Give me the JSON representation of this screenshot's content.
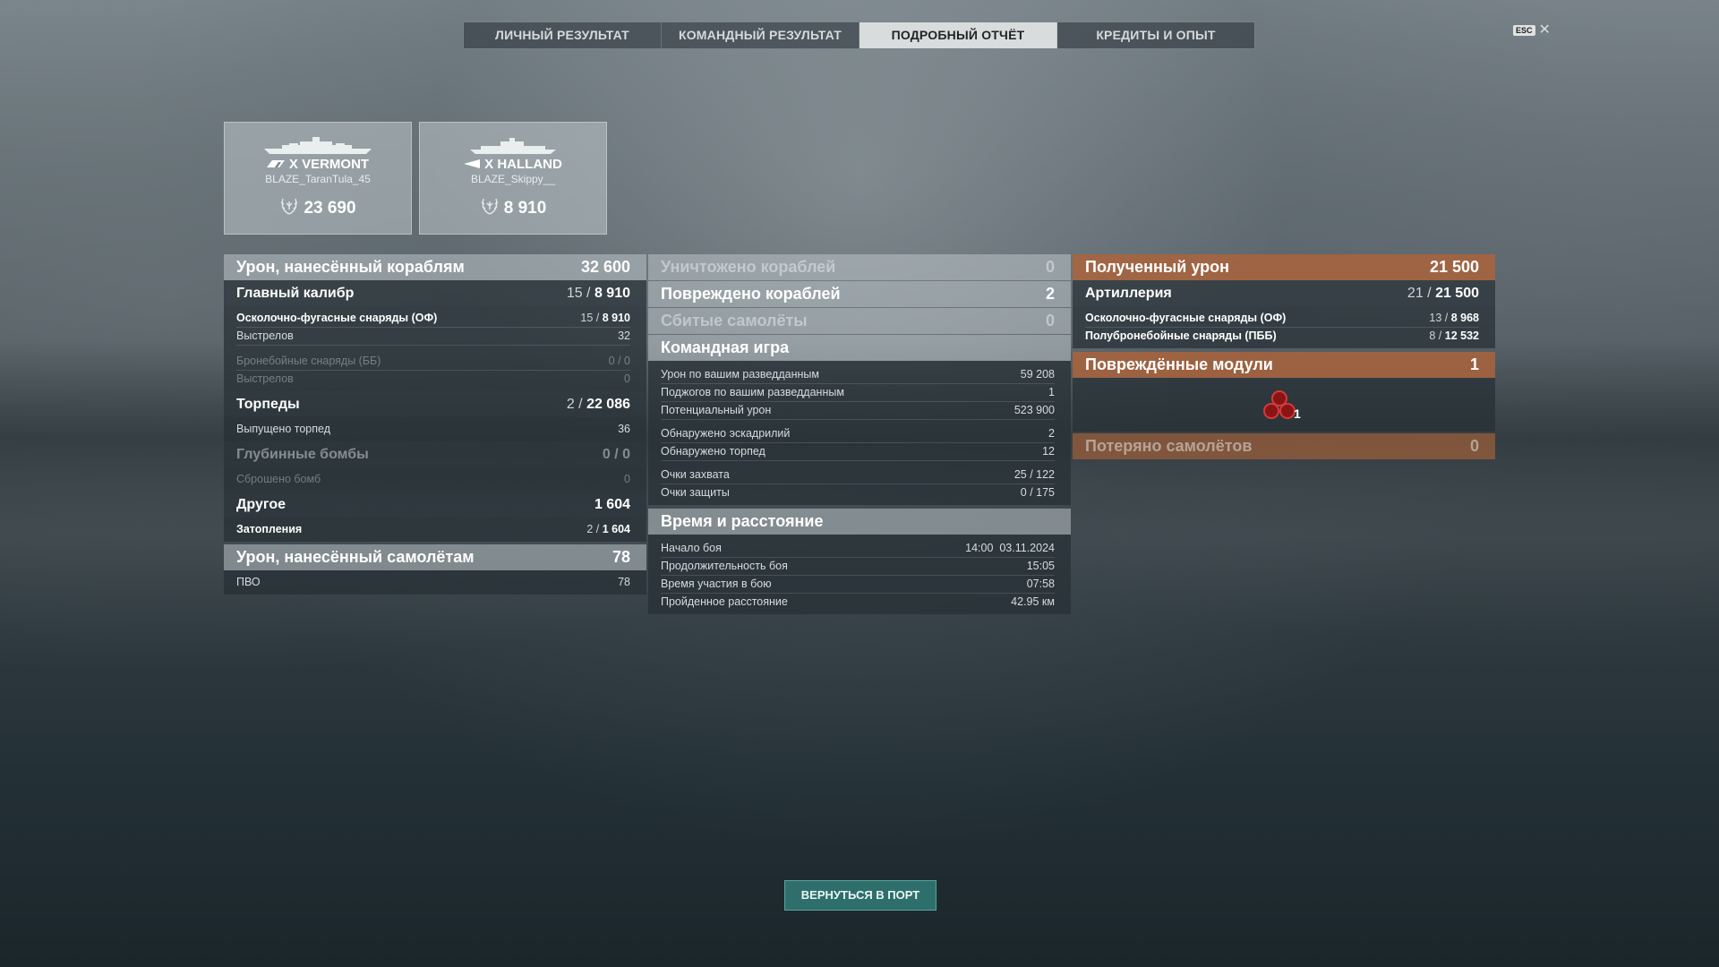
{
  "tabs": [
    "ЛИЧНЫЙ РЕЗУЛЬТАТ",
    "КОМАНДНЫЙ РЕЗУЛЬТАТ",
    "ПОДРОБНЫЙ ОТЧЁТ",
    "КРЕДИТЫ И ОПЫТ"
  ],
  "active_tab": "ПОДРОБНЫЙ ОТЧЁТ",
  "esc": {
    "key": "ESC",
    "close": "✕"
  },
  "ships": [
    {
      "name": "X VERMONT",
      "player": "BLAZE_TaranTula_45",
      "score": "23 690"
    },
    {
      "name": "X HALLAND",
      "player": "BLAZE_Skippy__",
      "score": "8 910"
    }
  ],
  "left": {
    "ship_damage": {
      "label": "Урон, нанесённый кораблям",
      "value": "32 600"
    },
    "main_battery": {
      "label": "Главный калибр",
      "hits": "15 /",
      "value": "8 910"
    },
    "he": {
      "label": "Осколочно-фугасные снаряды (ОФ)",
      "hits": "15 /",
      "value": "8 910"
    },
    "he_shots": {
      "label": "Выстрелов",
      "value": "32"
    },
    "ap": {
      "label": "Бронебойные снаряды (ББ)",
      "value": "0 / 0"
    },
    "ap_shots": {
      "label": "Выстрелов",
      "value": "0"
    },
    "torpedoes": {
      "label": "Торпеды",
      "hits": "2 /",
      "value": "22 086"
    },
    "torps_launched": {
      "label": "Выпущено торпед",
      "value": "36"
    },
    "depth_charges": {
      "label": "Глубинные бомбы",
      "value": "0 / 0"
    },
    "bombs_dropped": {
      "label": "Сброшено бомб",
      "value": "0"
    },
    "other": {
      "label": "Другое",
      "value": "1 604"
    },
    "flooding": {
      "label": "Затопления",
      "hits": "2 /",
      "value": "1 604"
    },
    "plane_damage": {
      "label": "Урон, нанесённый самолётам",
      "value": "78"
    },
    "aa": {
      "label": "ПВО",
      "value": "78"
    }
  },
  "middle": {
    "destroyed": {
      "label": "Уничтожено кораблей",
      "value": "0"
    },
    "damaged": {
      "label": "Повреждено кораблей",
      "value": "2"
    },
    "planes_shot": {
      "label": "Сбитые самолёты",
      "value": "0"
    },
    "teamplay": {
      "label": "Командная игра"
    },
    "spot_damage": {
      "label": "Урон по вашим разведданным",
      "value": "59 208"
    },
    "spot_fires": {
      "label": "Поджогов по вашим разведданным",
      "value": "1"
    },
    "potential": {
      "label": "Потенциальный урон",
      "value": "523 900"
    },
    "squadrons": {
      "label": "Обнаружено эскадрилий",
      "value": "2"
    },
    "torps_spotted": {
      "label": "Обнаружено торпед",
      "value": "12"
    },
    "capture": {
      "label": "Очки захвата",
      "value": "25 / 122"
    },
    "defense": {
      "label": "Очки защиты",
      "value": "0 / 175"
    },
    "time_header": {
      "label": "Время и расстояние"
    },
    "start": {
      "label": "Начало боя",
      "value": "14:00  03.11.2024"
    },
    "duration": {
      "label": "Продолжительность боя",
      "value": "15:05"
    },
    "participation": {
      "label": "Время участия в бою",
      "value": "07:58"
    },
    "distance": {
      "label": "Пройденное расстояние",
      "value": "42.95 км"
    }
  },
  "right": {
    "received": {
      "label": "Полученный урон",
      "value": "21 500"
    },
    "artillery": {
      "label": "Артиллерия",
      "hits": "21 /",
      "value": "21 500"
    },
    "he": {
      "label": "Осколочно-фугасные снаряды (ОФ)",
      "hits": "13 /",
      "value": "8 968"
    },
    "sap": {
      "label": "Полубронебойные снаряды (ПББ)",
      "hits": "8 /",
      "value": "12 532"
    },
    "modules": {
      "label": "Повреждённые модули",
      "value": "1",
      "icon_count": "1"
    },
    "planes_lost": {
      "label": "Потеряно самолётов",
      "value": "0"
    }
  },
  "button": {
    "label": "ВЕРНУТЬСЯ В ПОРТ"
  },
  "colors": {
    "orange_header": "#aa643c",
    "button": "#2f6f6b"
  }
}
